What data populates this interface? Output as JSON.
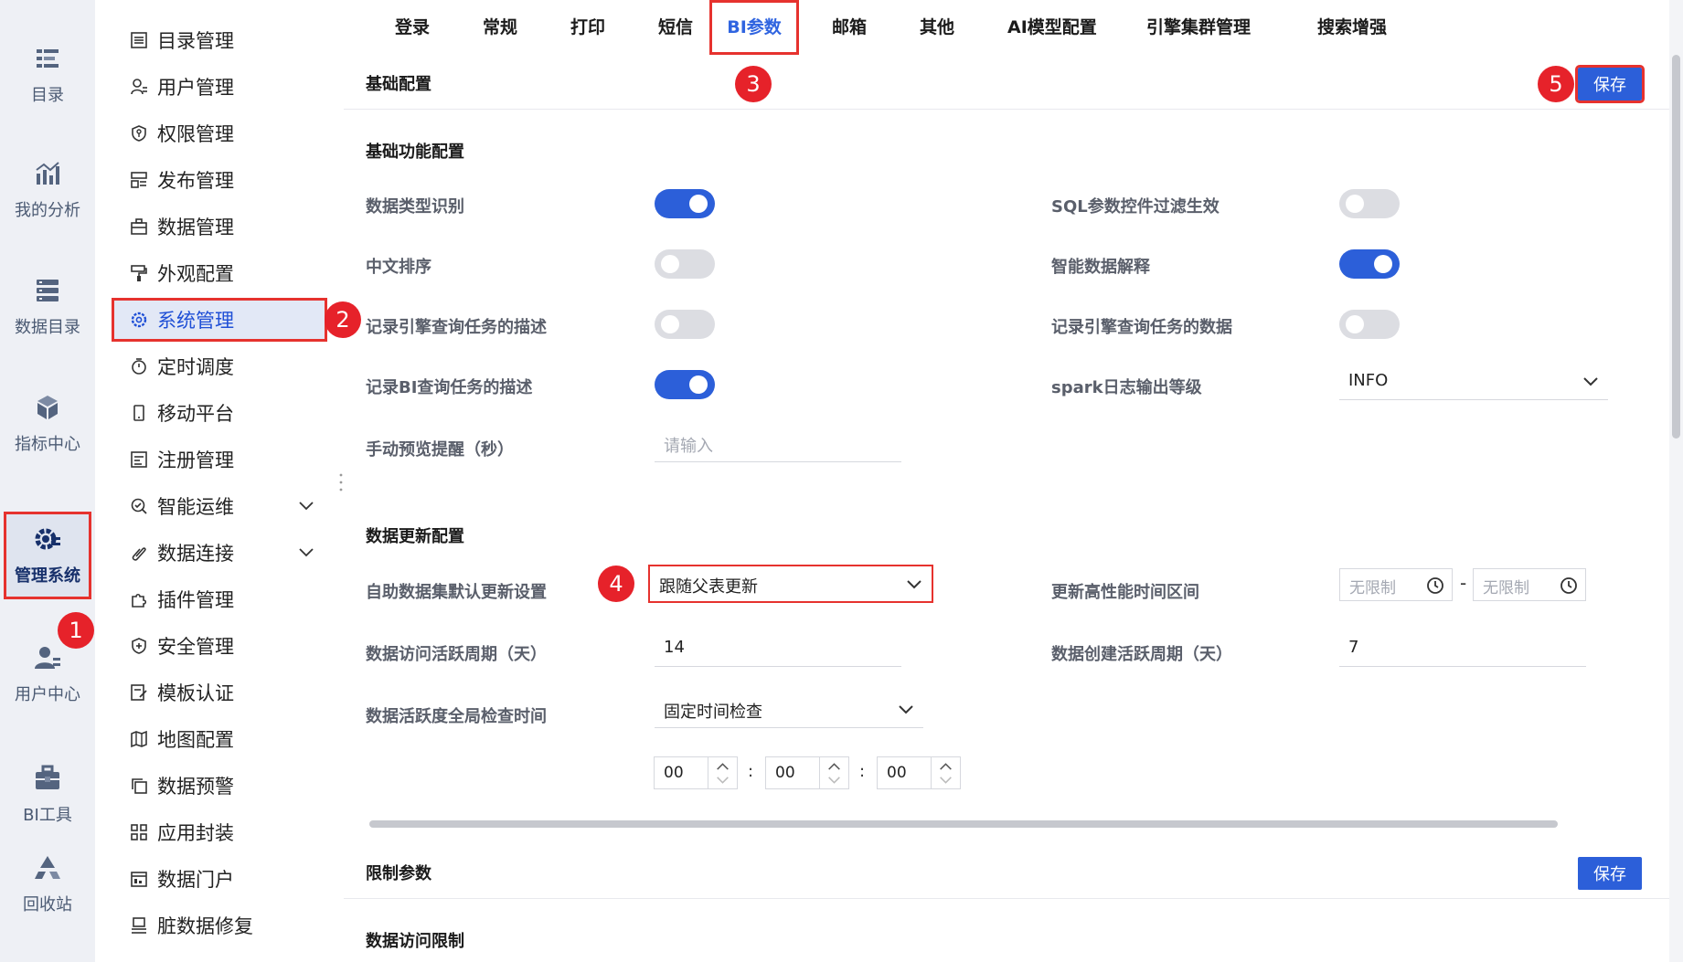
{
  "rail": [
    {
      "id": "catalog",
      "label": "目录",
      "icon": "catalog-icon"
    },
    {
      "id": "analysis",
      "label": "我的分析",
      "icon": "chart-icon"
    },
    {
      "id": "data-catalog",
      "label": "数据目录",
      "icon": "database-icon"
    },
    {
      "id": "metrics",
      "label": "指标中心",
      "icon": "cube-icon"
    },
    {
      "id": "admin",
      "label": "管理系统",
      "icon": "gear-admin-icon"
    },
    {
      "id": "user-center",
      "label": "用户中心",
      "icon": "user-icon"
    },
    {
      "id": "bi-tools",
      "label": "BI工具",
      "icon": "toolbox-icon"
    },
    {
      "id": "recycle",
      "label": "回收站",
      "icon": "recycle-icon"
    }
  ],
  "menu": [
    {
      "label": "目录管理",
      "icon": "list-icon"
    },
    {
      "label": "用户管理",
      "icon": "user-outline-icon"
    },
    {
      "label": "权限管理",
      "icon": "shield-key-icon"
    },
    {
      "label": "发布管理",
      "icon": "publish-icon"
    },
    {
      "label": "数据管理",
      "icon": "briefcase-icon"
    },
    {
      "label": "外观配置",
      "icon": "paint-roller-icon"
    },
    {
      "label": "系统管理",
      "icon": "settings-icon"
    },
    {
      "label": "定时调度",
      "icon": "timer-icon"
    },
    {
      "label": "移动平台",
      "icon": "mobile-icon"
    },
    {
      "label": "注册管理",
      "icon": "register-icon"
    },
    {
      "label": "智能运维",
      "icon": "ops-icon"
    },
    {
      "label": "数据连接",
      "icon": "link-icon"
    },
    {
      "label": "插件管理",
      "icon": "puzzle-icon"
    },
    {
      "label": "安全管理",
      "icon": "shield-plus-icon"
    },
    {
      "label": "模板认证",
      "icon": "template-cert-icon"
    },
    {
      "label": "地图配置",
      "icon": "map-icon"
    },
    {
      "label": "数据预警",
      "icon": "copy-alert-icon"
    },
    {
      "label": "应用封装",
      "icon": "apps-icon"
    },
    {
      "label": "数据门户",
      "icon": "portal-icon"
    },
    {
      "label": "脏数据修复",
      "icon": "repair-icon"
    }
  ],
  "tabs": [
    "登录",
    "常规",
    "打印",
    "短信",
    "BI参数",
    "邮箱",
    "其他",
    "AI模型配置",
    "引擎集群管理",
    "搜索增强"
  ],
  "basic": {
    "title": "基础配置",
    "save": "保存",
    "section_function": "基础功能配置",
    "data_type_recognition": {
      "label": "数据类型识别",
      "on": true
    },
    "sql_param_filter": {
      "label": "SQL参数控件过滤生效",
      "on": false
    },
    "chinese_sort": {
      "label": "中文排序",
      "on": false
    },
    "smart_explain": {
      "label": "智能数据解释",
      "on": true
    },
    "log_engine_desc": {
      "label": "记录引擎查询任务的描述",
      "on": false
    },
    "log_engine_data": {
      "label": "记录引擎查询任务的数据",
      "on": false
    },
    "log_bi_desc": {
      "label": "记录BI查询任务的描述",
      "on": true
    },
    "spark_log_level": {
      "label": "spark日志输出等级",
      "value": "INFO"
    },
    "manual_preview": {
      "label": "手动预览提醒（秒）",
      "placeholder": "请输入"
    },
    "section_update": "数据更新配置",
    "self_update": {
      "label": "自助数据集默认更新设置",
      "value": "跟随父表更新"
    },
    "hp_time": {
      "label": "更新高性能时间区间",
      "start": "无限制",
      "sep": "-",
      "end": "无限制"
    },
    "access_active": {
      "label": "数据访问活跃周期（天）",
      "value": "14"
    },
    "create_active": {
      "label": "数据创建活跃周期（天）",
      "value": "7"
    },
    "global_check": {
      "label": "数据活跃度全局检查时间",
      "value": "固定时间检查"
    },
    "time": {
      "h": "00",
      "m": "00",
      "s": "00",
      "sep": ":"
    }
  },
  "limit": {
    "title": "限制参数",
    "save": "保存",
    "section_access": "数据访问限制"
  },
  "badges": [
    "1",
    "2",
    "3",
    "4",
    "5"
  ],
  "colors": {
    "accent": "#2c5fd9",
    "highlight": "#e6322e",
    "badge": "#e6222a"
  }
}
